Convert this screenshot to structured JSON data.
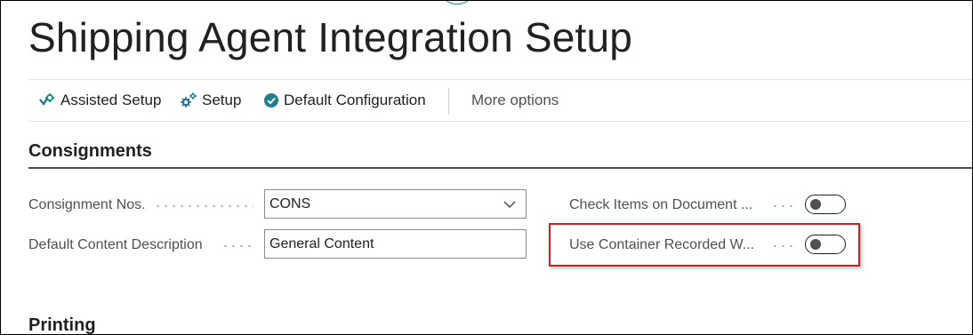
{
  "page": {
    "title": "Shipping Agent Integration Setup"
  },
  "actions": {
    "assisted_setup": "Assisted Setup",
    "setup": "Setup",
    "default_configuration": "Default Configuration",
    "more_options": "More options"
  },
  "sections": {
    "consignments": {
      "title": "Consignments",
      "consignment_nos_label": "Consignment Nos.",
      "consignment_nos_value": "CONS",
      "default_content_label": "Default Content Description",
      "default_content_value": "General Content",
      "check_items_label": "Check Items on Document ...",
      "check_items_value": false,
      "use_container_label": "Use Container Recorded W...",
      "use_container_value": false
    },
    "printing": {
      "title": "Printing"
    }
  },
  "colors": {
    "accent": "#1f8a8a",
    "highlight": "#d11f1f",
    "text": "#212121",
    "label": "#505050"
  }
}
